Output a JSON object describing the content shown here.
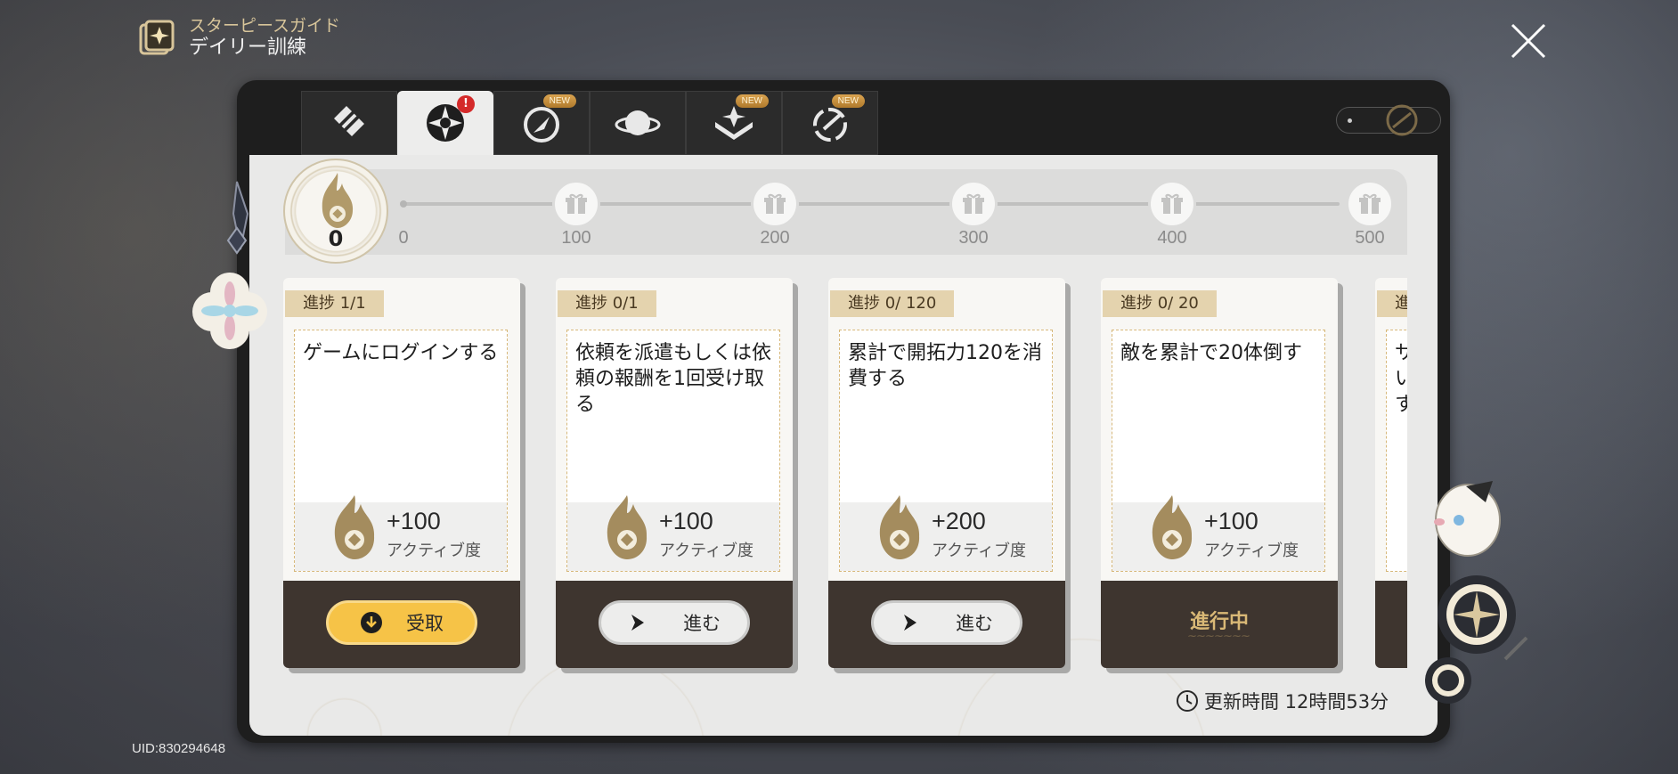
{
  "header": {
    "subtitle": "スターピースガイド",
    "title": "デイリー訓練"
  },
  "uid": "UID:830294648",
  "tabs": [
    {
      "icon": "ticket-icon",
      "active": false,
      "badge": ""
    },
    {
      "icon": "daily-training-icon",
      "active": true,
      "badge": "!"
    },
    {
      "icon": "compass-icon",
      "active": false,
      "badge": "NEW"
    },
    {
      "icon": "planet-icon",
      "active": false,
      "badge": ""
    },
    {
      "icon": "book-icon",
      "active": false,
      "badge": "NEW"
    },
    {
      "icon": "target-icon",
      "active": false,
      "badge": "NEW"
    }
  ],
  "activity": {
    "current": "0",
    "start_label": "0",
    "milestones": [
      "100",
      "200",
      "300",
      "400",
      "500"
    ]
  },
  "cards": [
    {
      "progress": "進捗 1/1",
      "desc": "ゲームにログインする",
      "reward": "+100",
      "unit": "アクティブ度",
      "action": "受取",
      "state": "claim"
    },
    {
      "progress": "進捗 0/1",
      "desc": "依頼を派遣もしくは依頼の報酬を1回受け取る",
      "reward": "+100",
      "unit": "アクティブ度",
      "action": "進む",
      "state": "go"
    },
    {
      "progress": "進捗 0/ 120",
      "desc": "累計で開拓力120を消費する",
      "reward": "+200",
      "unit": "アクティブ度",
      "action": "進む",
      "state": "go"
    },
    {
      "progress": "進捗 0/ 20",
      "desc": "敵を累計で20体倒す",
      "reward": "+100",
      "unit": "アクティブ度",
      "action": "進行中",
      "state": "inprogress"
    }
  ],
  "partial_card": {
    "progress": "進",
    "desc": "サいす"
  },
  "refresh": "更新時間 12時間53分",
  "colors": {
    "accent_gold": "#f6c347",
    "dark_brown": "#3e352f",
    "tag_beige": "#e4d3ae",
    "alert_red": "#d42a2a"
  }
}
